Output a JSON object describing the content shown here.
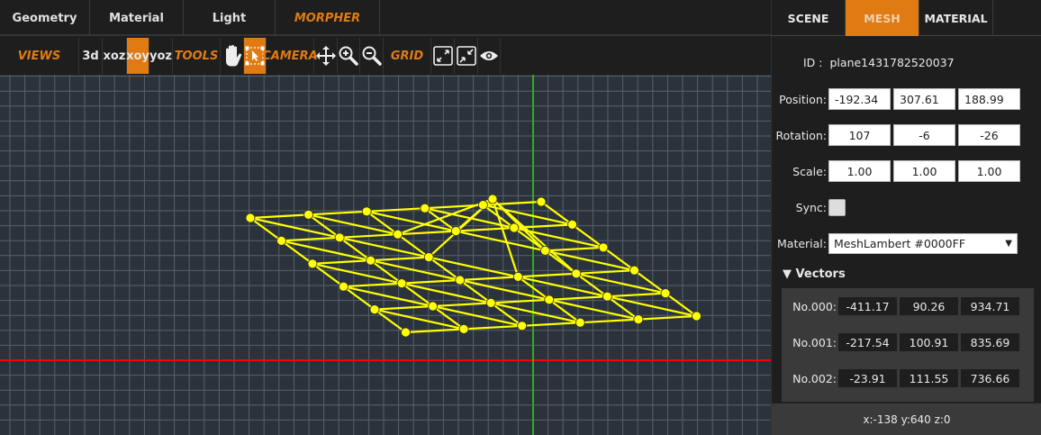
{
  "top_tabs": [
    {
      "label": "Geometry"
    },
    {
      "label": "Material"
    },
    {
      "label": "Light"
    },
    {
      "label": "MORPHER"
    }
  ],
  "toolbar": {
    "views_label": "VIEWS",
    "views": [
      "3d",
      "xoz",
      "xoy",
      "yoz"
    ],
    "active_view": "xoy",
    "tools_label": "TOOLS",
    "tools": [
      "hand-icon",
      "select-box-icon"
    ],
    "active_tool": "select-box-icon",
    "camera_label": "CAMERA",
    "camera": [
      "move-icon",
      "zoom-in-icon",
      "zoom-out-icon"
    ],
    "grid_label": "GRID",
    "grid": [
      "expand-icon",
      "shrink-icon",
      "eye-icon"
    ]
  },
  "colors": {
    "accent": "#E07B14",
    "mesh": "#FFFF00",
    "x_axis": "#FF0000",
    "y_axis": "#33AA22",
    "viewport_bg": "#2A323B"
  },
  "right_tabs": [
    {
      "label": "SCENE"
    },
    {
      "label": "MESH"
    },
    {
      "label": "MATERIAL"
    }
  ],
  "active_right_tab": "MESH",
  "mesh": {
    "id_label": "ID :",
    "id": "plane1431782520037",
    "position_label": "Position:",
    "position": [
      "-192.34",
      "307.61",
      "188.99"
    ],
    "rotation_label": "Rotation:",
    "rotation": [
      "107",
      "-6",
      "-26"
    ],
    "scale_label": "Scale:",
    "scale": [
      "1.00",
      "1.00",
      "1.00"
    ],
    "sync_label": "Sync:",
    "sync": false,
    "material_label": "Material:",
    "material": "MeshLambert #0000FF",
    "material_arrow": "▼",
    "vectors_label": "▼ Vectors",
    "vectors": [
      {
        "label": "No.000:",
        "values": [
          "-411.17",
          "90.26",
          "934.71"
        ]
      },
      {
        "label": "No.001:",
        "values": [
          "-217.54",
          "100.91",
          "835.69"
        ]
      },
      {
        "label": "No.002:",
        "values": [
          "-23.91",
          "111.55",
          "736.66"
        ]
      }
    ]
  },
  "status": "x:-138 y:640 z:0"
}
